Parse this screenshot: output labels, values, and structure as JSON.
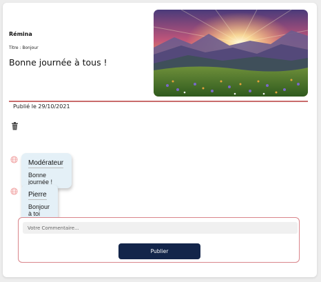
{
  "post": {
    "author": "Rémina",
    "title_line": "Titre : Bonjour",
    "text": "Bonne journée à tous !",
    "image": {
      "description_icon": "mountain-sunset-image"
    },
    "published": "Publié le 29/10/2021"
  },
  "actions": {
    "delete_icon": "trash-icon"
  },
  "comments": [
    {
      "author": "Modérateur",
      "text": "Bonne journée !",
      "icon": "globe-icon"
    },
    {
      "author": "Pierre",
      "text": "Bonjour à toi aussi !",
      "icon": "globe-icon"
    }
  ],
  "form": {
    "placeholder": "Votre Commentaire...",
    "submit_label": "Publier"
  },
  "colors": {
    "divider": "#c96b6b",
    "bubble": "#e4f0f7",
    "button": "#13254a",
    "form_border": "#d9848a"
  }
}
